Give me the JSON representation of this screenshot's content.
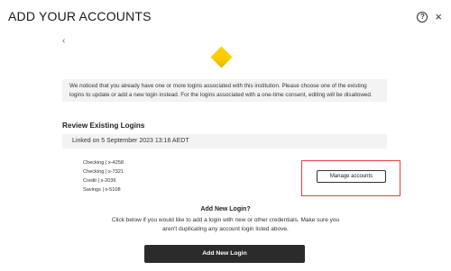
{
  "header": {
    "title": "ADD YOUR ACCOUNTS",
    "help_icon": "question-circle-icon",
    "help_glyph": "?",
    "close_icon": "close-icon",
    "close_glyph": "×"
  },
  "back": {
    "icon": "chevron-left-icon",
    "glyph": "‹"
  },
  "institution": {
    "logo_icon": "yellow-diamond-logo",
    "color": "#ffcc00"
  },
  "notice": {
    "text": "We noticed that you already have one or more logins associated with this institution. Please choose one of the existing logins to update or add a new login instead. For the logins associated with a one-time consent, editing will be disallowed."
  },
  "existing": {
    "title": "Review Existing Logins",
    "linked_on": "Linked on 5 September 2023 13:16 AEDT",
    "accounts": [
      "Checking | x-4258",
      "Checking | x-7321",
      "Credit | x-2036",
      "Savings | x-5108"
    ],
    "manage_label": "Manage accounts",
    "highlight_color": "#e04040"
  },
  "add_new": {
    "title": "Add New Login?",
    "description": "Click below if you would like to add a login with new or other credentials. Make sure you aren't duplicating any account login listed above.",
    "button_label": "Add New Login"
  }
}
